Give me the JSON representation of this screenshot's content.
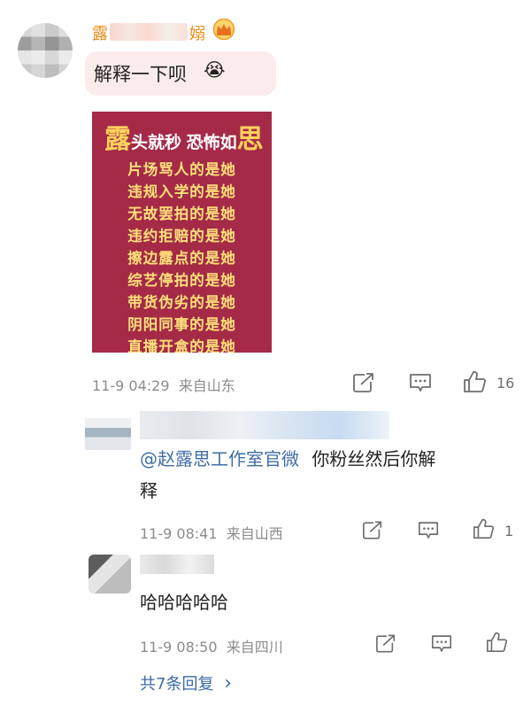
{
  "comment": {
    "username_start": "露",
    "username_end": "嫋",
    "text": "解释一下呗",
    "emoji": "😭",
    "card": {
      "title_char_1": "露",
      "title_part_1": "头就秒",
      "title_part_2": "恐怖如",
      "title_char_2": "思",
      "lines": [
        "片场骂人的是她",
        "违规入学的是她",
        "无故罢拍的是她",
        "违约拒赔的是她",
        "擦边露点的是她",
        "综艺停拍的是她",
        "带货伪劣的是她",
        "阴阳同事的是她",
        "直播开盒的是她"
      ]
    },
    "time": "11-9 04:29",
    "location": "来自山东",
    "likes": "16"
  },
  "reply1": {
    "mention": "@赵露思工作室官微",
    "text_part1": "你粉丝然后你解",
    "text_part2": "释",
    "time": "11-9 08:41",
    "location": "来自山西",
    "likes": "1"
  },
  "reply2": {
    "text": "哈哈哈哈哈",
    "time": "11-9 08:50",
    "location": "来自四川"
  },
  "footer": {
    "more_replies": "共7条回复",
    "chevron": "›"
  },
  "colors": {
    "username": "#e98a15",
    "bubble": "#fbeceb",
    "card_bg": "#a42a47",
    "card_text": "#ffe07a",
    "mention": "#3f6ea8",
    "meta": "#8c8c8c"
  }
}
